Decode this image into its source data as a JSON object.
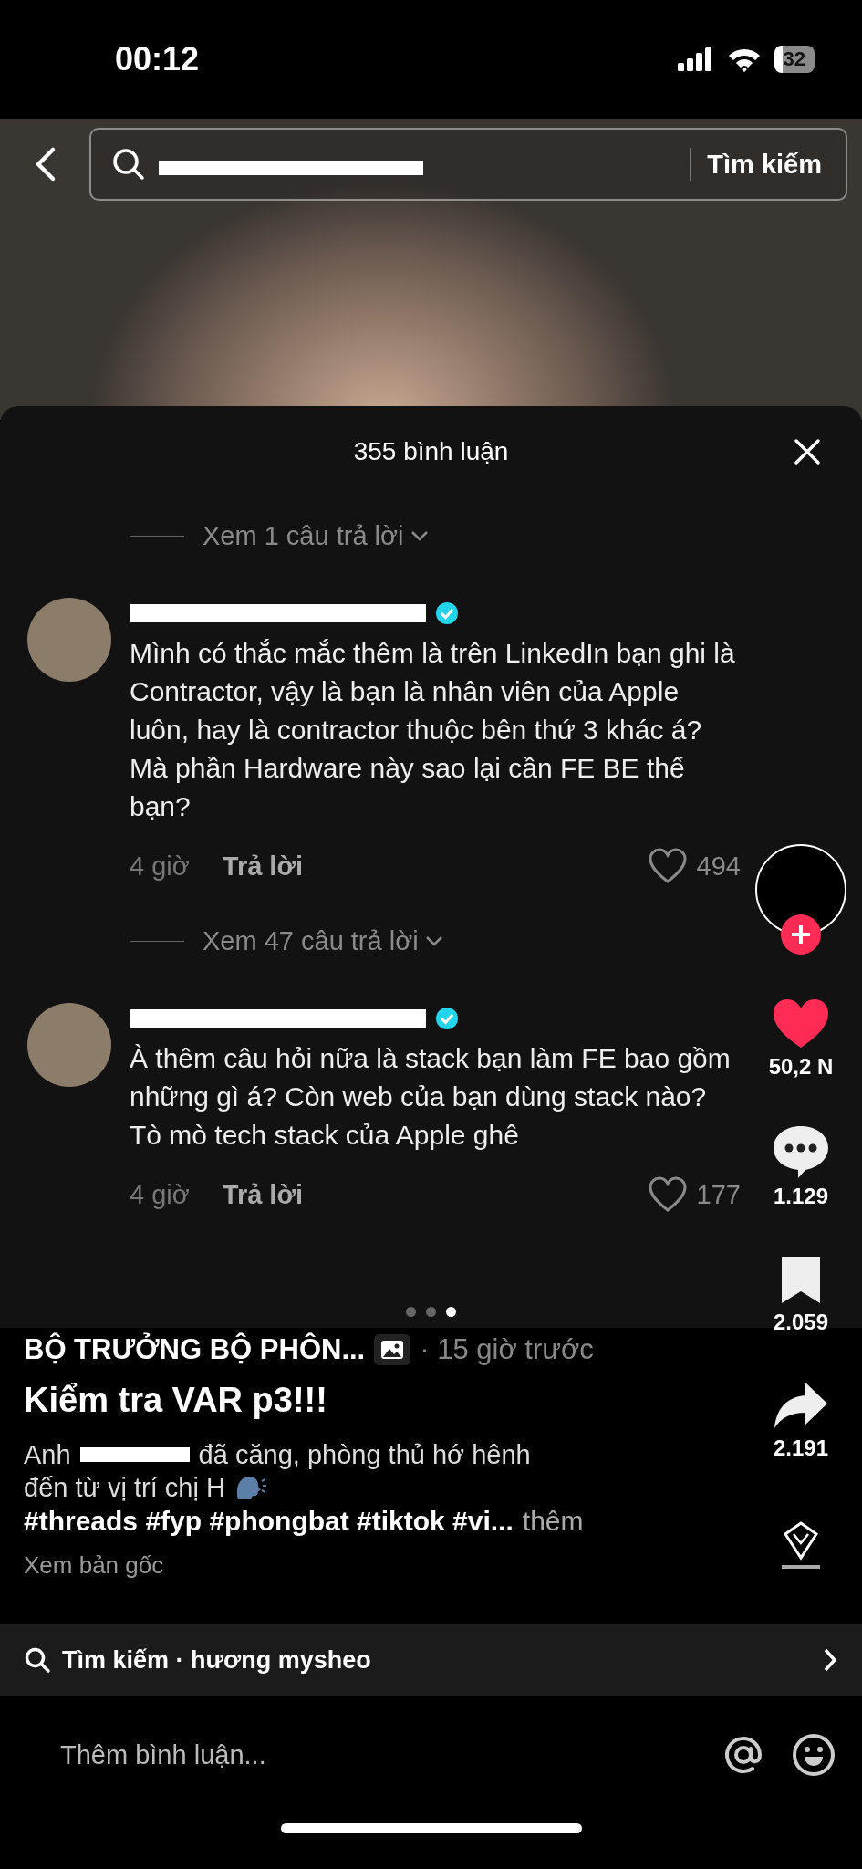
{
  "status_bar": {
    "time": "00:12",
    "battery": "32"
  },
  "search": {
    "button": "Tìm kiếm"
  },
  "comments_panel": {
    "title": "355 bình luận",
    "items": [
      {
        "kind": "replies",
        "text": "Xem 1 câu trả lời"
      },
      {
        "kind": "comment",
        "verified": true,
        "text": "Mình có thắc mắc thêm là trên LinkedIn bạn ghi là Contractor, vậy là bạn là nhân viên của Apple luôn, hay là contractor thuộc bên thứ 3 khác á? Mà phần Hardware này sao lại cần FE BE thế bạn?",
        "time": "4 giờ",
        "reply": "Trả lời",
        "likes": "494"
      },
      {
        "kind": "replies",
        "text": "Xem 47 câu trả lời"
      },
      {
        "kind": "comment",
        "verified": true,
        "text": "À thêm câu hỏi nữa là stack bạn làm FE bao gồm những gì á? Còn web của bạn dùng stack nào? Tò mò tech stack của Apple ghê",
        "time": "4 giờ",
        "reply": "Trả lời",
        "likes": "177"
      }
    ],
    "page_dots": [
      {
        "selected": false
      },
      {
        "selected": false
      },
      {
        "selected": true
      }
    ]
  },
  "actions": {
    "liked": true,
    "likes": "50,2 N",
    "comments": "1.129",
    "saves": "2.059",
    "shares": "2.191"
  },
  "post": {
    "author": "BỘ TRƯỞNG BỘ PHÔN...",
    "time": "· 15 giờ trước",
    "title": "Kiểm tra VAR p3!!!",
    "caption_start": "Anh",
    "caption_rest": "đã căng, phòng thủ hớ hênh",
    "caption_line_2": "đến từ vị trí chị H",
    "hashtags": "#threads #fyp #phongbat #tiktok #vi...",
    "more": "thêm",
    "original": "Xem bản gốc"
  },
  "search_suggestion": {
    "text": "Tìm kiếm · hương mysheo"
  },
  "comment_input": {
    "placeholder": "Thêm bình luận..."
  }
}
